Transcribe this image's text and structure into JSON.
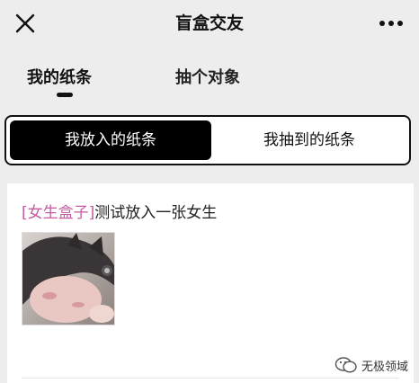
{
  "navbar": {
    "title": "盲盒交友",
    "close_icon": "close-icon",
    "more_icon": "more-dots-icon"
  },
  "tabs": [
    {
      "label": "我的纸条",
      "active": true
    },
    {
      "label": "抽个对象",
      "active": false
    }
  ],
  "segmented": {
    "options": [
      {
        "label": "我放入的纸条",
        "selected": true
      },
      {
        "label": "我抽到的纸条",
        "selected": false
      }
    ]
  },
  "note": {
    "tag": "[女生盒子]",
    "text": "测试放入一张女生",
    "photo_icon": "user-photo"
  },
  "watermark": {
    "text": "无极领域",
    "icon": "wechat-logo-icon"
  },
  "colors": {
    "background": "#ededed",
    "card": "#ffffff",
    "accent_tag": "#c25c9e",
    "selected_segment": "#000000"
  }
}
